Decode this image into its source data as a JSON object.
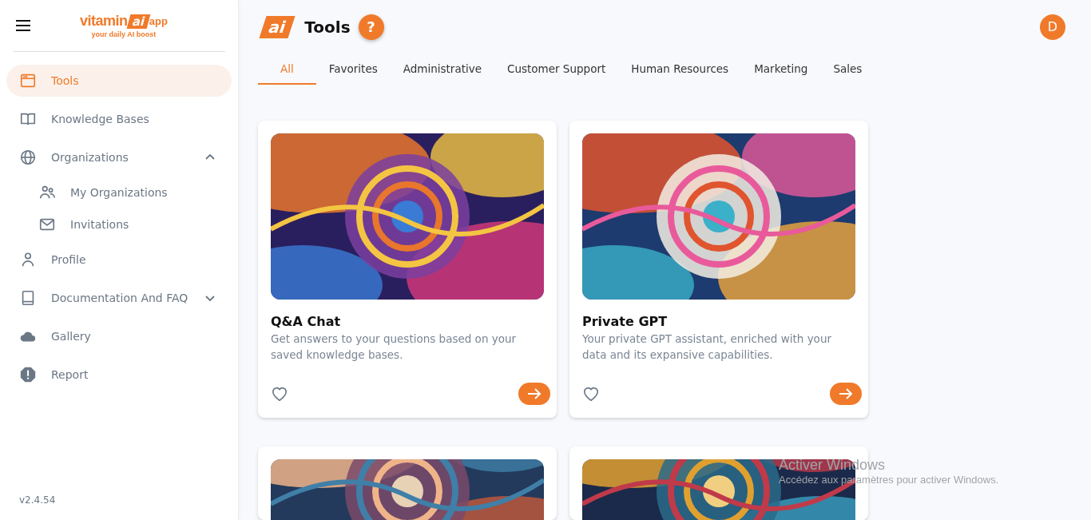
{
  "logo": {
    "word": "vitamin",
    "mark": "ai",
    "suffix": "app",
    "tagline": "your daily AI boost"
  },
  "sidebar": {
    "items": [
      {
        "label": "Tools",
        "selected": true
      },
      {
        "label": "Knowledge Bases",
        "selected": false
      },
      {
        "label": "Organizations",
        "selected": false,
        "expanded": true,
        "children": [
          {
            "label": "My Organizations",
            "selected": false
          },
          {
            "label": "Invitations",
            "selected": false
          }
        ]
      },
      {
        "label": "Profile",
        "selected": false
      },
      {
        "label": "Documentation And FAQ",
        "selected": false,
        "expanded": false
      },
      {
        "label": "Gallery",
        "selected": false
      },
      {
        "label": "Report",
        "selected": false
      }
    ],
    "version": "v2.4.54"
  },
  "header": {
    "mark": "ai",
    "title": "Tools",
    "help": "?",
    "avatar": "D"
  },
  "tabs": [
    {
      "label": "All",
      "selected": true
    },
    {
      "label": "Favorites",
      "selected": false
    },
    {
      "label": "Administrative",
      "selected": false
    },
    {
      "label": "Customer Support",
      "selected": false
    },
    {
      "label": "Human Resources",
      "selected": false
    },
    {
      "label": "Marketing",
      "selected": false
    },
    {
      "label": "Sales",
      "selected": false
    }
  ],
  "cards": [
    {
      "kind": "tool",
      "title": "Q&A Chat",
      "description": "Get answers to your questions based on your saved knowledge bases.",
      "favorite": false
    },
    {
      "kind": "tool",
      "title": "Private GPT",
      "description": "Your private GPT assistant, enriched with your data and its expansive capabilities.",
      "favorite": false
    },
    {
      "kind": "picture"
    },
    {
      "kind": "picture"
    }
  ],
  "windows_notice": {
    "title": "Activer Windows",
    "text": "Accédez aux paramètres pour activer Windows."
  }
}
